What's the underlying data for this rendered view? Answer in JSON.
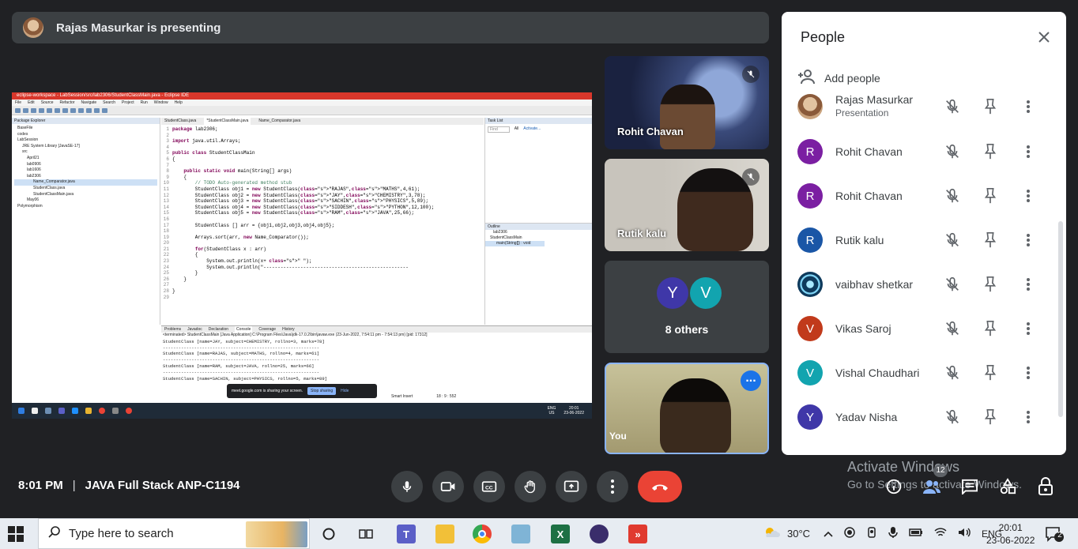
{
  "presenter_banner": {
    "text": "Rajas Masurkar is presenting"
  },
  "shared_screen": {
    "window_title": "eclipse-workspace - LabSession/src/lab2306/StudentClassMain.java - Eclipse IDE",
    "menu": [
      "File",
      "Edit",
      "Source",
      "Refactor",
      "Navigate",
      "Search",
      "Project",
      "Run",
      "Window",
      "Help"
    ],
    "package_explorer": {
      "title": "Package Explorer",
      "items": [
        "BaseFile",
        "codes",
        "LabSession",
        "JRE System Library [JavaSE-17]",
        "src",
        "April21",
        "lab0906",
        "lab1606",
        "lab2306",
        "Name_Comparator.java",
        "StudentClass.java",
        "StudentClassMain.java",
        "May06",
        "Polymorphism"
      ]
    },
    "editor_tabs": [
      "StudentClass.java",
      "*StudentClassMain.java",
      "Name_Comparator.java"
    ],
    "code_lines": [
      "package lab2306;",
      "",
      "import java.util.Arrays;",
      "",
      "public class StudentClassMain",
      "{",
      "",
      "    public static void main(String[] args)",
      "    {",
      "        // TODO Auto-generated method stub",
      "        StudentClass obj1 = new StudentClass(\"RAJAS\",\"MATHS\",4,61);",
      "        StudentClass obj2 = new StudentClass(\"JAY\",\"CHEMISTRY\",3,78);",
      "        StudentClass obj3 = new StudentClass(\"SACHIN\",\"PHYSICS\",5,89);",
      "        StudentClass obj4 = new StudentClass(\"SIDDESH\",\"PYTHON\",12,100);",
      "        StudentClass obj5 = new StudentClass(\"RAM\",\"JAVA\",25,66);",
      "",
      "        StudentClass [] arr = {obj1,obj2,obj3,obj4,obj5};",
      "",
      "        Arrays.sort(arr, new Name_Comparator());",
      "",
      "        for(StudentClass x : arr)",
      "        {",
      "            System.out.println(x+ \" \");",
      "            System.out.println(\"---------------------------------------------------",
      "        }",
      "    }",
      "",
      "}",
      ""
    ],
    "task_list": {
      "title": "Task List",
      "find": "Find",
      "all": "All",
      "activate": "Activate..."
    },
    "outline": {
      "title": "Outline",
      "items": [
        "lab2306",
        "StudentClassMain",
        "main(String[]) : void"
      ]
    },
    "console_tabs": [
      "Problems",
      "Javadoc",
      "Declaration",
      "Console",
      "Coverage",
      "History"
    ],
    "console_lines": [
      "<terminated> StudentClassMain [Java Application] C:\\Program Files\\Java\\jdk-17.0.2\\bin\\javaw.exe (23-Jun-2022, 7:54:11 pm - 7:54:13 pm) [pid: 17312]",
      "StudentClass [name=JAY, subject=CHEMISTRY, rollno=3, marks=78]",
      "------------------------------------------------------------",
      "StudentClass [name=RAJAS, subject=MATHS, rollno=4, marks=61]",
      "------------------------------------------------------------",
      "StudentClass [name=RAM, subject=JAVA, rollno=25, marks=66]",
      "------------------------------------------------------------",
      "StudentClass [name=SACHIN, subject=PHYSICS, rollno=5, marks=89]"
    ],
    "share_notice": {
      "text": "meet.google.com is sharing your screen.",
      "stop": "Stop sharing",
      "hide": "Hide"
    },
    "status": {
      "smart_insert": "Smart Insert",
      "position": "18 : 9 : 552"
    },
    "inner_clock": {
      "time": "20:01",
      "date": "23-06-2022",
      "lang": "ENG",
      "region": "US"
    }
  },
  "tiles": [
    {
      "name": "Rohit Chavan",
      "muted": true
    },
    {
      "name": "Rutik kalu",
      "muted": true
    },
    {
      "others_label": "8 others",
      "avatars": [
        {
          "letter": "Y",
          "color": "#3f37a8"
        },
        {
          "letter": "V",
          "color": "#12a4af"
        }
      ]
    },
    {
      "name": "You",
      "more": "..."
    }
  ],
  "people_panel": {
    "title": "People",
    "add_people": "Add people",
    "participants": [
      {
        "name": "Rajas Masurkar",
        "subtitle": "Presentation",
        "avatar_letter": "",
        "avatar_color": "#8a5a3a"
      },
      {
        "name": "Rohit Chavan",
        "subtitle": "",
        "avatar_letter": "R",
        "avatar_color": "#7b1fa2"
      },
      {
        "name": "Rohit Chavan",
        "subtitle": "",
        "avatar_letter": "R",
        "avatar_color": "#7b1fa2"
      },
      {
        "name": "Rutik kalu",
        "subtitle": "",
        "avatar_letter": "R",
        "avatar_color": "#1a56a6"
      },
      {
        "name": "vaibhav shetkar",
        "subtitle": "",
        "avatar_letter": "",
        "avatar_color": "#0e3a5c"
      },
      {
        "name": "Vikas Saroj",
        "subtitle": "",
        "avatar_letter": "V",
        "avatar_color": "#c13a1b"
      },
      {
        "name": "Vishal Chaudhari",
        "subtitle": "",
        "avatar_letter": "V",
        "avatar_color": "#12a4af"
      },
      {
        "name": "Yadav Nisha",
        "subtitle": "",
        "avatar_letter": "Y",
        "avatar_color": "#3f37a8"
      }
    ]
  },
  "watermark": {
    "line1": "Activate Windows",
    "line2": "Go to Settings to activate Windows."
  },
  "meeting": {
    "time": "8:01 PM",
    "separator": "|",
    "title": "JAVA Full Stack ANP-C1194",
    "participant_count": "12"
  },
  "taskbar": {
    "search_placeholder": "Type here to search",
    "weather": "30°C",
    "language": "ENG",
    "time": "20:01",
    "date": "23-06-2022",
    "notifications": "2"
  },
  "colors": {
    "accent": "#8ab4f8",
    "end_call": "#ea4335",
    "background": "#202124",
    "control": "#3c4043"
  }
}
